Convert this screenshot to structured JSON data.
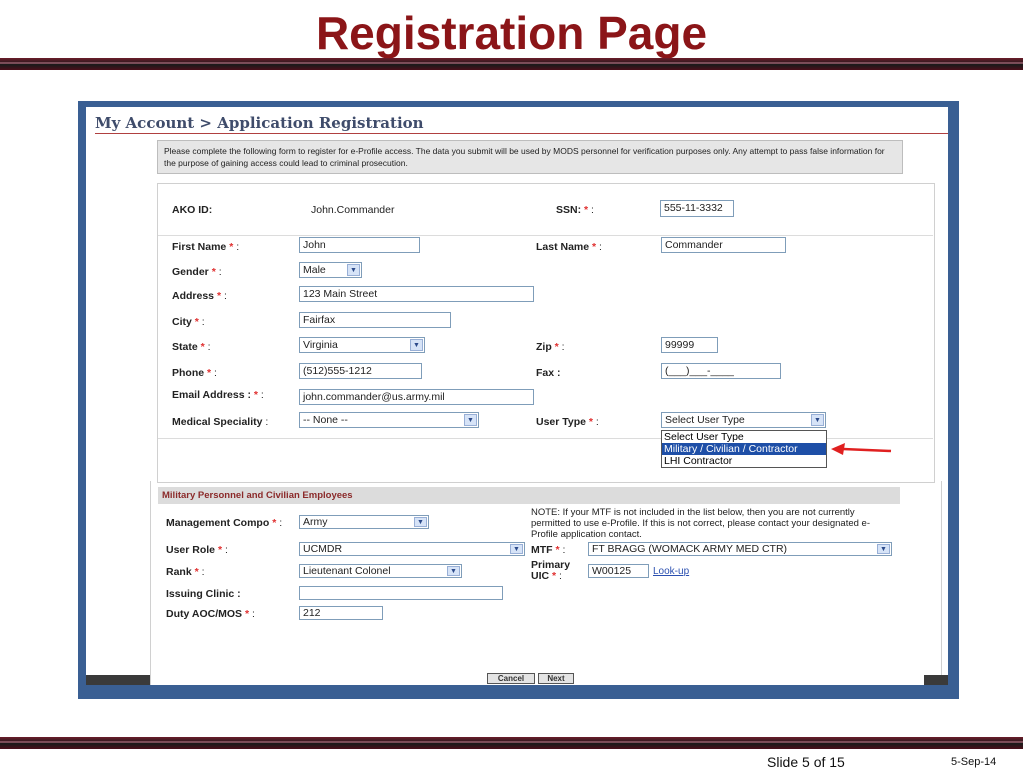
{
  "slide": {
    "title": "Registration Page",
    "slide_label": "Slide 5 of 15",
    "date": "5-Sep-14"
  },
  "breadcrumb": "My Account > Application Registration",
  "notice": "Please complete the following form to register for e-Profile access. The data you submit will be used by MODS personnel for verification purposes only. Any attempt to pass false information for the purpose of gaining access could lead to criminal prosecution.",
  "form": {
    "ako_id": {
      "label": "AKO ID:",
      "value": "John.Commander"
    },
    "ssn": {
      "label": "SSN:",
      "value": "555-11-3332"
    },
    "first_name": {
      "label": "First Name",
      "value": "John"
    },
    "last_name": {
      "label": "Last Name",
      "value": "Commander"
    },
    "gender": {
      "label": "Gender",
      "value": "Male"
    },
    "address": {
      "label": "Address",
      "value": "123 Main Street"
    },
    "city": {
      "label": "City",
      "value": "Fairfax"
    },
    "state": {
      "label": "State",
      "value": "Virginia"
    },
    "zip": {
      "label": "Zip",
      "value": "99999"
    },
    "phone": {
      "label": "Phone",
      "value": "(512)555-1212"
    },
    "fax": {
      "label": "Fax :",
      "value": "(___)___-____"
    },
    "email": {
      "label": "Email Address :",
      "value": "john.commander@us.army.mil"
    },
    "medical_speciality": {
      "label": "Medical Speciality",
      "value": "-- None --"
    },
    "user_type": {
      "label": "User Type",
      "value": "Select User Type",
      "options": [
        "Select User Type",
        "Military / Civilian / Contractor",
        "LHI Contractor"
      ],
      "highlighted": "Military / Civilian / Contractor"
    }
  },
  "military": {
    "header": "Military Personnel and Civilian Employees",
    "note": "NOTE: If your MTF is not included in the list below, then you are not currently permitted to use e-Profile. If this is not correct, please contact your designated e-Profile application contact.",
    "management_compo": {
      "label": "Management Compo",
      "value": "Army"
    },
    "user_role": {
      "label": "User Role",
      "value": "UCMDR"
    },
    "mtf": {
      "label": "MTF",
      "value": "FT BRAGG (WOMACK ARMY MED CTR)"
    },
    "rank": {
      "label": "Rank",
      "value": "Lieutenant Colonel"
    },
    "primary_uic": {
      "label_line1": "Primary",
      "label_line2": "UIC",
      "value": "W00125",
      "lookup": "Look-up"
    },
    "issuing_clinic": {
      "label": "Issuing Clinic :",
      "value": ""
    },
    "duty_aoc_mos": {
      "label": "Duty AOC/MOS",
      "value": "212"
    }
  },
  "buttons": {
    "cancel": "Cancel",
    "next": "Next"
  },
  "colors": {
    "title": "#8b1518",
    "frame": "#3a5f93",
    "highlight": "#1e4fa7",
    "required": "#e03030",
    "arrow": "#e02020"
  }
}
